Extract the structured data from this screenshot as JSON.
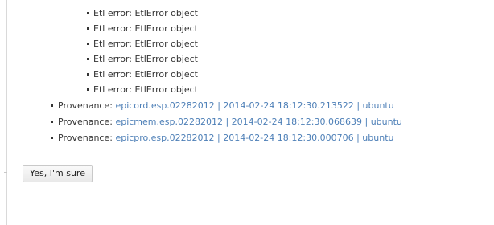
{
  "etl_errors": [
    {
      "label": "Etl error: ",
      "value": "EtlError object"
    },
    {
      "label": "Etl error: ",
      "value": "EtlError object"
    },
    {
      "label": "Etl error: ",
      "value": "EtlError object"
    },
    {
      "label": "Etl error: ",
      "value": "EtlError object"
    },
    {
      "label": "Etl error: ",
      "value": "EtlError object"
    },
    {
      "label": "Etl error: ",
      "value": "EtlError object"
    }
  ],
  "provenances": [
    {
      "label": "Provenance: ",
      "name": "epicord.esp.02282012",
      "separator_1": " | ",
      "timestamp": "2014-02-24 18:12:30.213522",
      "separator_2": " | ",
      "user": "ubuntu"
    },
    {
      "label": "Provenance: ",
      "name": "epicmem.esp.02282012",
      "separator_1": " | ",
      "timestamp": "2014-02-24 18:12:30.068639",
      "separator_2": " | ",
      "user": "ubuntu"
    },
    {
      "label": "Provenance: ",
      "name": "epicpro.esp.02282012",
      "separator_1": " | ",
      "timestamp": "2014-02-24 18:12:30.000706",
      "separator_2": " | ",
      "user": "ubuntu"
    }
  ],
  "confirm_button": {
    "label": "Yes, I'm sure"
  },
  "colors": {
    "link": "#4d7fb7",
    "text": "#333333"
  }
}
